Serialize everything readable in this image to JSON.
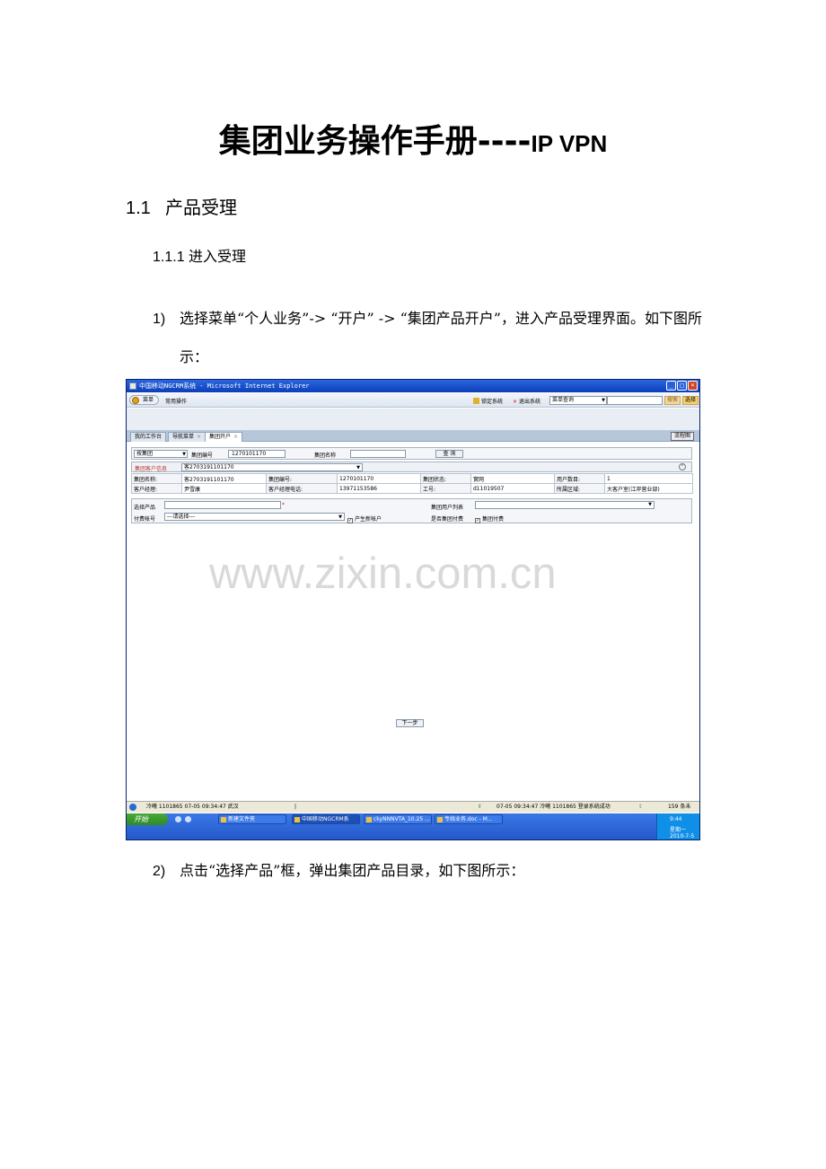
{
  "doc": {
    "title_main": "集团业务操作手册----",
    "title_suffix": "IP VPN",
    "section_num": "1.1",
    "section_title": "产品受理",
    "subsection": "1.1.1  进入受理",
    "step1_num": "1)",
    "step1_text": "选择菜单“个人业务”-> “开户” -> “集团产品开户”，进入产品受理界面。如下图所",
    "step1_cont": "示：",
    "step2_num": "2)",
    "step2_text": "点击“选择产品”框，弹出集团产品目录，如下图所示："
  },
  "screenshot": {
    "window_title": "中国移动NGCRM系统 - Microsoft Internet Explorer",
    "menu_label": "菜单",
    "common_ops": "常用操作",
    "lock_system": "锁定系统",
    "exit_system": "退出系统",
    "menu_query": "菜单查询",
    "search_btn": "搜索",
    "select_btn": "选择",
    "tabs": [
      "我的工作台",
      "导航菜单",
      "集团开户"
    ],
    "flowchart_btn": "流程图",
    "by_group": "按集团",
    "group_no_label": "集团编号",
    "group_no_value": "1270101170",
    "group_name_label": "集团名称",
    "query_btn": "查 询",
    "cust_info_label": "集团客户信息",
    "cust_select_value": "客2703191101170",
    "info_table": [
      [
        "集团名称:",
        "客2703191101170",
        "集团编号:",
        "1270101170",
        "集团状态:",
        "實网",
        "用户数目:",
        "1"
      ],
      [
        "客户经理:",
        "尹雪康",
        "客户经理电话:",
        "13971153586",
        "工号:",
        "d11019507",
        "所属区域:",
        "大客户室(江岸营业部)"
      ]
    ],
    "choose_product_label": "选择产品",
    "required_mark": "*",
    "group_user_list_label": "集团用户列表",
    "pay_account_label": "付费帐号",
    "pay_account_value": "---请选择---",
    "new_account_label": "产生新帐户",
    "group_pay_question": "是否集团付费",
    "group_pay_label": "集团付费",
    "watermark": "www.zixin.com.cn",
    "next_btn": "下一步",
    "status_left": "冷曦 1101865 07-05 09:34:47 武汉",
    "status_sep": "|",
    "status_mid": "07-05 09:34:47 冷曦 1101865 登录系统成功",
    "status_right": "159 条未读..",
    "start_label": "开始",
    "taskbar_items": [
      "新建文件夹",
      "中国移动NGCRM系",
      "ckyNNNVTA_10.25 ...",
      "专线业务.doc - M..."
    ],
    "tray_time": "9:44",
    "tray_day": "星期一",
    "tray_date": "2010-7-5"
  }
}
